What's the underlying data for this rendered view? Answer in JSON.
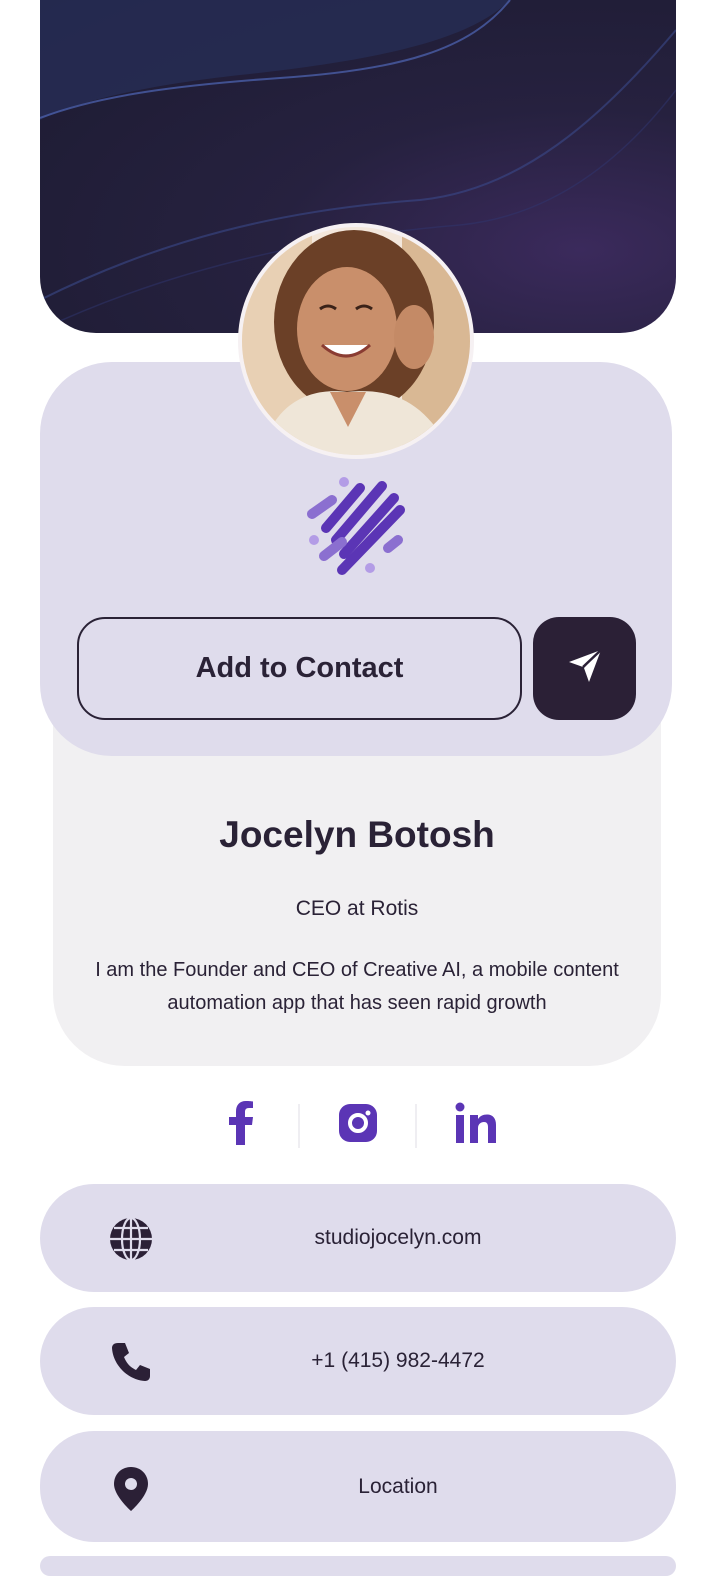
{
  "profile": {
    "name": "Jocelyn Botosh",
    "title": "CEO at Rotis",
    "bio": "I am the Founder and CEO of Creative AI, a mobile content automation app that has seen rapid growth"
  },
  "actions": {
    "add_contact_label": "Add to Contact",
    "share_icon": "send-icon"
  },
  "social": {
    "items": [
      {
        "name": "facebook",
        "icon": "facebook-icon"
      },
      {
        "name": "instagram",
        "icon": "instagram-icon"
      },
      {
        "name": "linkedin",
        "icon": "linkedin-icon"
      }
    ]
  },
  "contact": {
    "website": {
      "icon": "globe-icon",
      "text": "studiojocelyn.com"
    },
    "phone": {
      "icon": "phone-icon",
      "text": "+1 (415) 982-4472"
    },
    "location": {
      "icon": "location-pin-icon",
      "text": "Location"
    }
  },
  "colors": {
    "accent": "#5b35b5",
    "accent_light": "#8b6fd0",
    "card": "#dfdcec",
    "dark": "#2b2036"
  }
}
